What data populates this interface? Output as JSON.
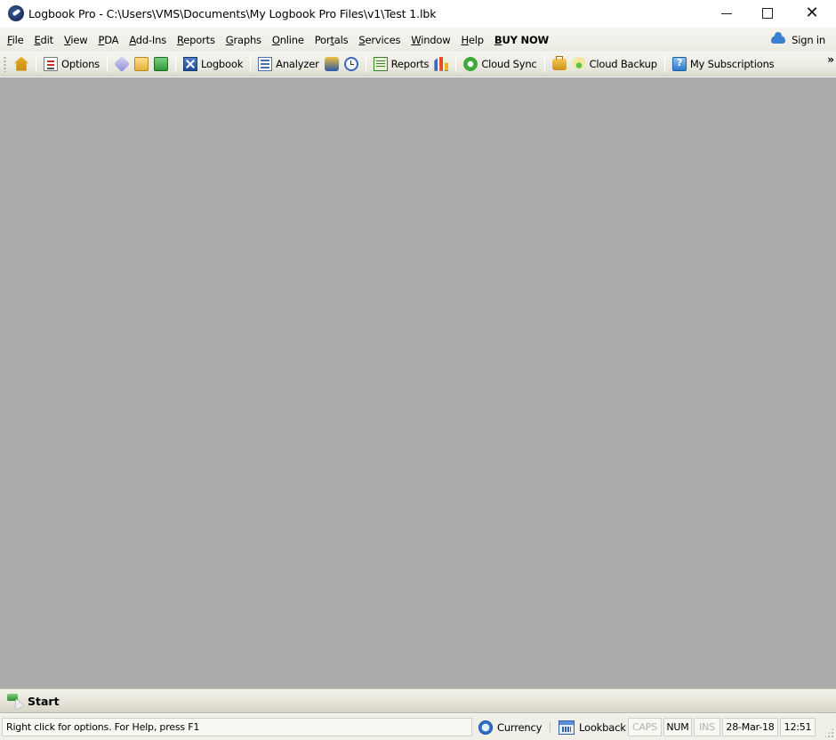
{
  "window": {
    "title": "Logbook Pro - C:\\Users\\VMS\\Documents\\My Logbook Pro Files\\v1\\Test 1.lbk",
    "controls": {
      "minimize": "minimize",
      "maximize": "maximize",
      "close": "close"
    }
  },
  "menubar": {
    "items": [
      {
        "label": "File",
        "accel": "F"
      },
      {
        "label": "Edit",
        "accel": "E"
      },
      {
        "label": "View",
        "accel": "V"
      },
      {
        "label": "PDA",
        "accel": "P"
      },
      {
        "label": "Add-Ins",
        "accel": "A"
      },
      {
        "label": "Reports",
        "accel": "R"
      },
      {
        "label": "Graphs",
        "accel": "G"
      },
      {
        "label": "Online",
        "accel": "O"
      },
      {
        "label": "Portals",
        "accel": "t"
      },
      {
        "label": "Services",
        "accel": "S"
      },
      {
        "label": "Window",
        "accel": "W"
      },
      {
        "label": "Help",
        "accel": "H"
      },
      {
        "label": "BUY NOW",
        "accel": "B"
      }
    ],
    "sign_in": "Sign in"
  },
  "toolbar": {
    "home_icon": "home-icon",
    "options": "Options",
    "logbook": "Logbook",
    "analyzer": "Analyzer",
    "reports": "Reports",
    "cloud_sync": "Cloud Sync",
    "cloud_backup": "Cloud Backup",
    "my_subscriptions": "My Subscriptions",
    "overflow": "»"
  },
  "startbar": {
    "label": "Start"
  },
  "statusbar": {
    "message": "Right click for options. For Help, press F1",
    "currency": "Currency",
    "lookback": "Lookback",
    "caps": "CAPS",
    "num": "NUM",
    "ins": "INS",
    "date": "28-Mar-18",
    "time": "12:51"
  }
}
